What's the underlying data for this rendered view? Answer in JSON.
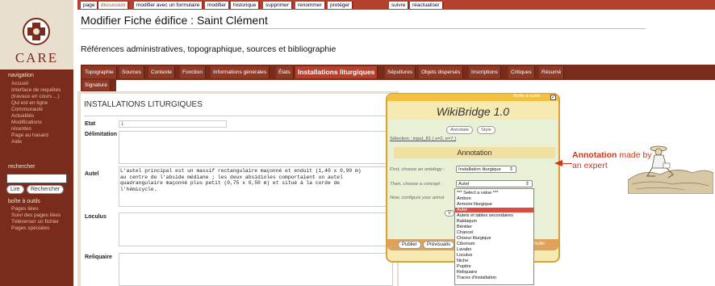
{
  "sidebar": {
    "logo": "CARE",
    "nav_title": "navigation",
    "nav_items": [
      "Accueil",
      "Interface de requêtes",
      "(travaux en cours ...)",
      "Qui est en ligne",
      "Communauté",
      "Actualités",
      "Modifications",
      "récentes",
      "Page au hasard",
      "Aide"
    ],
    "search_title": "rechercher",
    "read_btn": "Lire",
    "search_btn": "Rechercher",
    "tools_title": "boîte à outils",
    "tools_items": [
      "Pages liées",
      "Suivi des pages liées",
      "Téléverser un fichier",
      "Pages spéciales"
    ]
  },
  "page_tabs": [
    "page",
    "discussion",
    "modifier avec un formulaire",
    "modifier",
    "historique",
    "supprimer",
    "renommer",
    "protéger",
    "suivre",
    "réactualiser"
  ],
  "main": {
    "title": "Modifier Fiche édifice : Saint Clément",
    "subtitle": "Références administratives, topographique, sources et bibliographie"
  },
  "tabs": [
    "Topographie",
    "Sources",
    "Contexte",
    "Fonction",
    "Informations générales",
    "États",
    "Installations liturgiques",
    "Sépultures",
    "Objets dispersés",
    "Inscriptions",
    "Critiques",
    "Résumé"
  ],
  "tabs_row2": [
    "Signature"
  ],
  "form": {
    "section": "INSTALLATIONS LITURGIQUES",
    "etat_label": "Etat",
    "etat_value": "1",
    "delimitation_label": "Délimitation",
    "autel_label": "Autel",
    "autel_text": [
      "L'autel principal est un massif rectangulaire maçonné et enduit (1,40 x 0,90 m)",
      "au centre de l'abside médiane ; les deux absidioles comportaient un autel",
      "quadrangulaire maçonné plus petit (0,75 x 0,50 m) et situé à la corde de",
      "l'hémicycle."
    ],
    "loculus_label": "Loculus",
    "reliquaire_label": "Reliquaire"
  },
  "wikibridge": {
    "toolbox": "Boîte à outils",
    "title": "WikiBridge 1.0",
    "annotate_btn": "Annotate",
    "style_btn": "Style",
    "selection": "Sélection : input_81 ( s=2, e=7 )",
    "annotation_title": "Annotation",
    "step1": "First, choose an ontology :",
    "ontology_value": "Installation liturgique",
    "step2": "Then, choose a concept :",
    "concept_value": "Autel",
    "step3": "Now, configure your annot",
    "v_btn": "V",
    "publish_btn": "Publier",
    "preview_btn": "Prévisualis",
    "cancel_btn": "nuler",
    "options": [
      "*** Select a value ***",
      "Ambon",
      "Armoire liturgique",
      "Autel",
      "Autels et tables secondaires",
      "Baldaquin",
      "Bénitier",
      "Chancel",
      "Choeur liturgique",
      "Ciborium",
      "Lavabo",
      "Loculus",
      "Niche",
      "Pupitre",
      "Reliquaire",
      "Traces d'installation"
    ],
    "selected_index": 3
  },
  "callout": {
    "line1_strong": "Annotation",
    "line1_rest": " made by",
    "line2": "an expert"
  },
  "colors": {
    "brand": "#7a2c1c",
    "accent": "#c8381c",
    "wb_bg": "#f7e9b2",
    "selected": "#dd4d3f"
  }
}
